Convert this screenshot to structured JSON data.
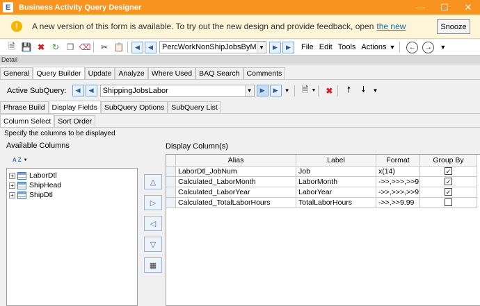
{
  "window": {
    "title": "Business Activity Query Designer",
    "app_icon_glyph": "E"
  },
  "notice": {
    "text": "A new version of this form is available. To try out the new design and provide feedback, open",
    "link": "the new",
    "snooze": "Snooze"
  },
  "toolbar": {
    "query_name": "PercWorkNonShipJobsByMon",
    "menu": [
      "File",
      "Edit",
      "Tools",
      "Actions"
    ]
  },
  "detail_label": "Detail",
  "main_tabs": [
    "General",
    "Query Builder",
    "Update",
    "Analyze",
    "Where Used",
    "BAQ Search",
    "Comments"
  ],
  "subquery": {
    "label": "Active SubQuery:",
    "value": "ShippingJobsLabor"
  },
  "sub_tabs": [
    "Phrase Build",
    "Display Fields",
    "SubQuery Options",
    "SubQuery List"
  ],
  "inner_tabs": [
    "Column Select",
    "Sort Order"
  ],
  "instructions": "Specify the columns to be displayed",
  "available_columns": {
    "title": "Available Columns",
    "sort_label": "A Z",
    "items": [
      "LaborDtl",
      "ShipHead",
      "ShipDtl"
    ]
  },
  "display_columns": {
    "title": "Display Column(s)",
    "headers": {
      "alias": "Alias",
      "label": "Label",
      "format": "Format",
      "group_by": "Group By"
    },
    "rows": [
      {
        "alias": "LaborDtl_JobNum",
        "label": "Job",
        "format": "x(14)",
        "group_by": true
      },
      {
        "alias": "Calculated_LaborMonth",
        "label": "LaborMonth",
        "format": "->>,>>>,>>9",
        "group_by": true
      },
      {
        "alias": "Calculated_LaborYear",
        "label": "LaborYear",
        "format": "->>,>>>,>>9",
        "group_by": true
      },
      {
        "alias": "Calculated_TotalLaborHours",
        "label": "TotalLaborHours",
        "format": "->>,>>9.99",
        "group_by": false
      }
    ]
  },
  "colors": {
    "titlebar": "#f7931e",
    "notice_bg": "#fff5d9",
    "accent_blue": "#3c74b6"
  }
}
